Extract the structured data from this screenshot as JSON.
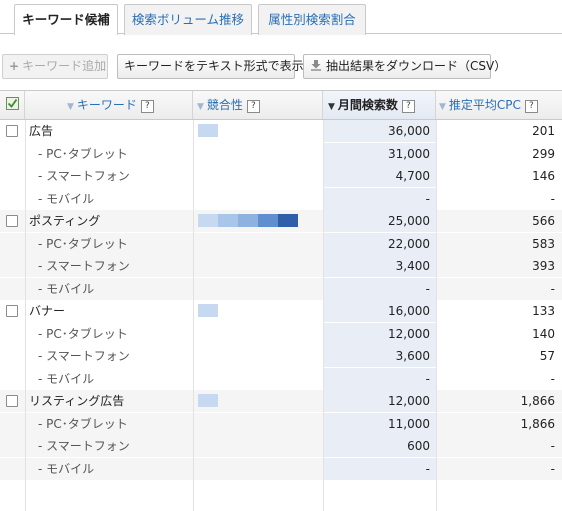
{
  "tabs": [
    {
      "label": "キーワード候補",
      "active": true
    },
    {
      "label": "検索ボリューム推移",
      "active": false
    },
    {
      "label": "属性別検索割合",
      "active": false
    }
  ],
  "toolbar": {
    "add_keyword": "キーワード追加",
    "show_text": "キーワードをテキスト形式で表示",
    "download": "抽出結果をダウンロード（CSV）"
  },
  "columns": {
    "keyword": "キーワード",
    "competition": "競合性",
    "monthly_searches": "月間検索数",
    "avg_cpc": "推定平均CPC",
    "help": "?"
  },
  "colors": {
    "competition_low": "#c6d9f1",
    "competition_1": "#c6d9f1",
    "competition_2": "#a9c6ea",
    "competition_3": "#8db2e0",
    "competition_4": "#5f8fcf",
    "competition_5": "#2e5fa8"
  },
  "rows": [
    {
      "keyword": "広告",
      "competition_level": 1,
      "searches": "36,000",
      "cpc": "201",
      "subs": [
        {
          "label": "- PC･タブレット",
          "searches": "31,000",
          "cpc": "299"
        },
        {
          "label": "- スマートフォン",
          "searches": "4,700",
          "cpc": "146"
        },
        {
          "label": "- モバイル",
          "searches": "-",
          "cpc": "-"
        }
      ]
    },
    {
      "keyword": "ポスティング",
      "competition_level": 5,
      "searches": "25,000",
      "cpc": "566",
      "subs": [
        {
          "label": "- PC･タブレット",
          "searches": "22,000",
          "cpc": "583"
        },
        {
          "label": "- スマートフォン",
          "searches": "3,400",
          "cpc": "393"
        },
        {
          "label": "- モバイル",
          "searches": "-",
          "cpc": "-"
        }
      ]
    },
    {
      "keyword": "バナー",
      "competition_level": 1,
      "searches": "16,000",
      "cpc": "133",
      "subs": [
        {
          "label": "- PC･タブレット",
          "searches": "12,000",
          "cpc": "140"
        },
        {
          "label": "- スマートフォン",
          "searches": "3,600",
          "cpc": "57"
        },
        {
          "label": "- モバイル",
          "searches": "-",
          "cpc": "-"
        }
      ]
    },
    {
      "keyword": "リスティング広告",
      "competition_level": 1,
      "searches": "12,000",
      "cpc": "1,866",
      "subs": [
        {
          "label": "- PC･タブレット",
          "searches": "11,000",
          "cpc": "1,866"
        },
        {
          "label": "- スマートフォン",
          "searches": "600",
          "cpc": "-"
        },
        {
          "label": "- モバイル",
          "searches": "-",
          "cpc": "-"
        }
      ]
    }
  ]
}
